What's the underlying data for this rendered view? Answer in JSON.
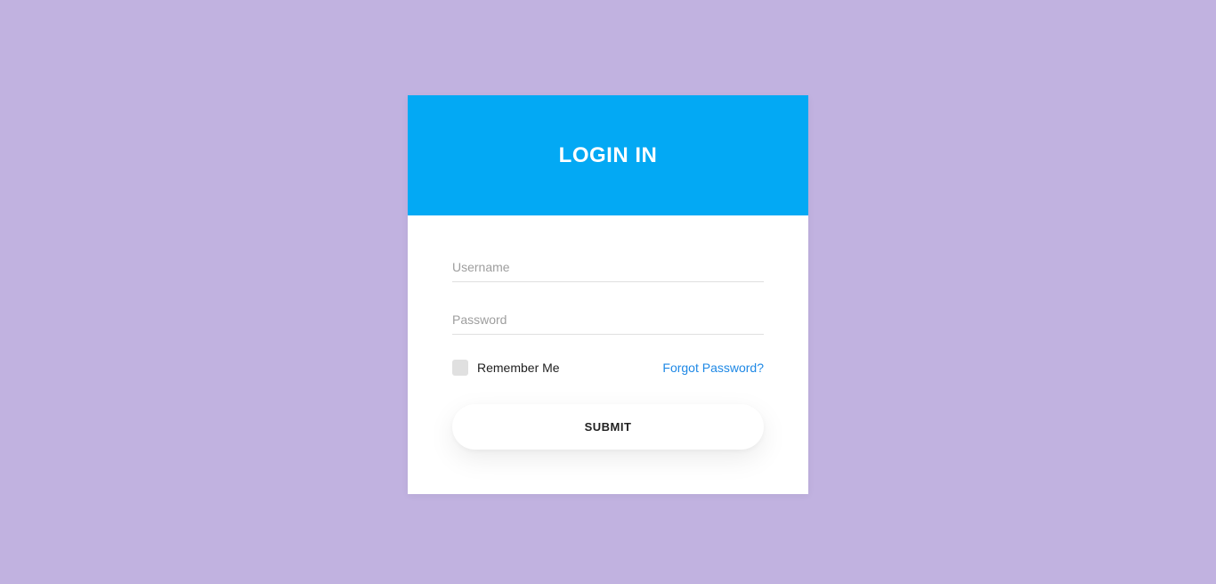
{
  "header": {
    "title": "LOGIN IN"
  },
  "form": {
    "username_placeholder": "Username",
    "password_placeholder": "Password",
    "remember_label": "Remember Me",
    "forgot_label": "Forgot Password?",
    "submit_label": "SUBMIT"
  }
}
